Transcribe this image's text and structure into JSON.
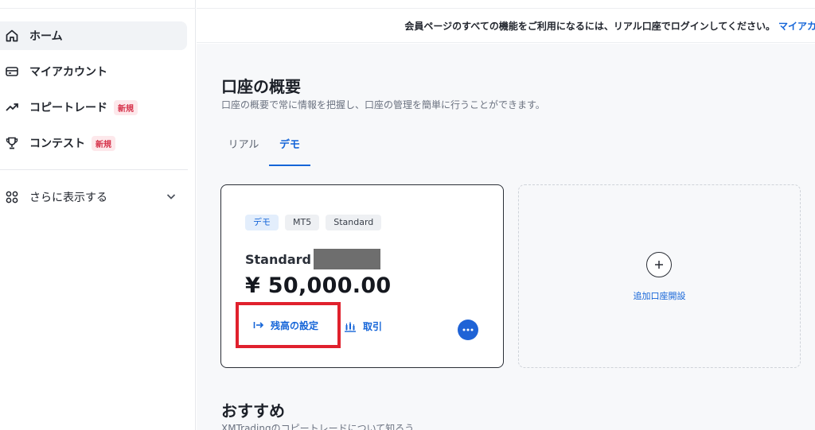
{
  "sidebar": {
    "items": [
      {
        "label": "ホーム",
        "icon": "home-icon",
        "active": true
      },
      {
        "label": "マイアカウント",
        "icon": "wallet-icon"
      },
      {
        "label": "コピートレード",
        "icon": "trending-up-icon",
        "badge": "新規"
      },
      {
        "label": "コンテスト",
        "icon": "trophy-icon",
        "badge": "新規"
      }
    ],
    "more": {
      "label": "さらに表示する",
      "icon": "grid-icon"
    }
  },
  "notice": {
    "text": "会員ページのすべての機能をご利用になるには、リアル口座でログインしてください。",
    "link": "マイアカ"
  },
  "main": {
    "title": "口座の概要",
    "subtitle": "口座の概要で常に情報を把握し、口座の管理を簡単に行うことができます。",
    "tabs": [
      {
        "label": "リアル",
        "active": false
      },
      {
        "label": "デモ",
        "active": true
      }
    ],
    "account_card": {
      "tags": [
        "デモ",
        "MT5",
        "Standard"
      ],
      "account_type": "Standard",
      "balance": "¥ 50,000.00",
      "actions": {
        "set_balance": "残高の設定",
        "trade": "取引"
      }
    },
    "add_account": {
      "label": "追加口座開設"
    },
    "recommend": {
      "title": "おすすめ",
      "subtitle": "XMTradingのコピートレードについて知ろう"
    }
  },
  "colors": {
    "accent": "#1565d8",
    "highlight_border": "#e0212d",
    "badge_red": "#d6324a"
  }
}
